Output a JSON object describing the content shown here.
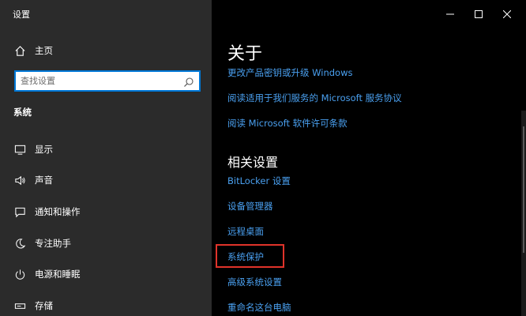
{
  "window": {
    "title": "设置"
  },
  "sidebar": {
    "home_label": "主页",
    "search_placeholder": "查找设置",
    "section_title": "系统",
    "items": [
      {
        "label": "显示",
        "icon": "monitor-icon"
      },
      {
        "label": "声音",
        "icon": "speaker-icon"
      },
      {
        "label": "通知和操作",
        "icon": "notification-icon"
      },
      {
        "label": "专注助手",
        "icon": "moon-icon"
      },
      {
        "label": "电源和睡眠",
        "icon": "power-icon"
      },
      {
        "label": "存储",
        "icon": "storage-icon"
      }
    ]
  },
  "content": {
    "title": "关于",
    "links": [
      "更改产品密钥或升级 Windows",
      "阅读适用于我们服务的 Microsoft 服务协议",
      "阅读 Microsoft 软件许可条款"
    ],
    "related_title": "相关设置",
    "related_links": [
      "BitLocker 设置",
      "设备管理器",
      "远程桌面",
      "系统保护",
      "高级系统设置",
      "重命名这台电脑"
    ]
  },
  "colors": {
    "sidebar_bg": "#2b2b2b",
    "content_bg": "#000000",
    "link": "#4aa0f0",
    "accent": "#0078d7",
    "highlight": "#e0332a"
  }
}
